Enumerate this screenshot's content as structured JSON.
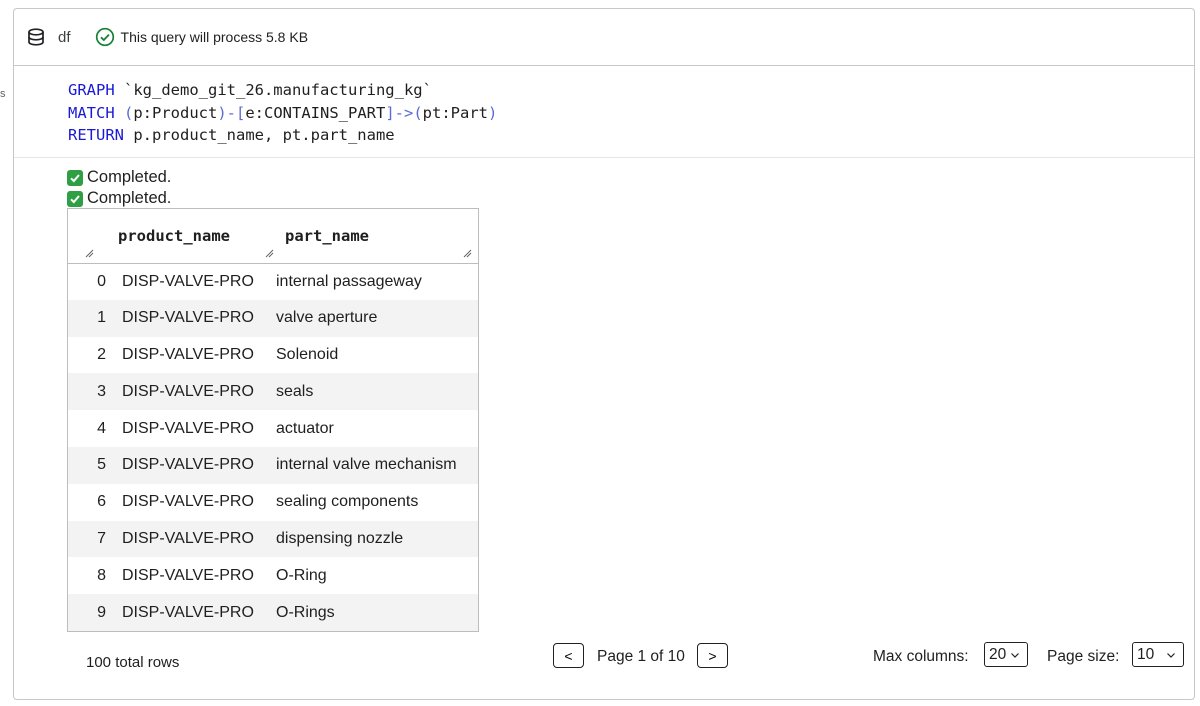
{
  "edge_fragment": "s",
  "header": {
    "dataframe_name": "df",
    "process_message": "This query will process 5.8 KB"
  },
  "code": {
    "line1": {
      "keyword": "GRAPH",
      "rest": " `kg_demo_git_26.manufacturing_kg`"
    },
    "line2": {
      "keyword": "MATCH",
      "open": " (",
      "node1": "p:Product",
      "arrow1": ")-[",
      "edge": "e:CONTAINS_PART",
      "arrow2": "]->(",
      "node2": "pt:Part",
      "close": ")"
    },
    "line3": {
      "keyword": "RETURN",
      "rest": " p.product_name, pt.part_name"
    }
  },
  "status": [
    "Completed.",
    "Completed."
  ],
  "table": {
    "columns": [
      "product_name",
      "part_name"
    ],
    "rows": [
      {
        "idx": "0",
        "product_name": "DISP-VALVE-PRO",
        "part_name": "internal passageway"
      },
      {
        "idx": "1",
        "product_name": "DISP-VALVE-PRO",
        "part_name": "valve aperture"
      },
      {
        "idx": "2",
        "product_name": "DISP-VALVE-PRO",
        "part_name": "Solenoid"
      },
      {
        "idx": "3",
        "product_name": "DISP-VALVE-PRO",
        "part_name": "seals"
      },
      {
        "idx": "4",
        "product_name": "DISP-VALVE-PRO",
        "part_name": "actuator"
      },
      {
        "idx": "5",
        "product_name": "DISP-VALVE-PRO",
        "part_name": "internal valve mechanism"
      },
      {
        "idx": "6",
        "product_name": "DISP-VALVE-PRO",
        "part_name": "sealing components"
      },
      {
        "idx": "7",
        "product_name": "DISP-VALVE-PRO",
        "part_name": "dispensing nozzle"
      },
      {
        "idx": "8",
        "product_name": "DISP-VALVE-PRO",
        "part_name": "O-Ring"
      },
      {
        "idx": "9",
        "product_name": "DISP-VALVE-PRO",
        "part_name": "O-Rings"
      }
    ]
  },
  "footer": {
    "total_rows": "100 total rows",
    "prev_label": "<",
    "page_info": "Page 1 of 10",
    "next_label": ">",
    "max_columns_label": "Max columns:",
    "max_columns_value": "20",
    "page_size_label": "Page size:",
    "page_size_value": "10"
  },
  "colors": {
    "keyword": "#1a1ad6",
    "operator": "#5b6ad6",
    "success_green": "#2ea043",
    "check_circle_green": "#188038"
  },
  "icons": [
    "database-icon",
    "check-circle-icon",
    "checkmark-box-icon",
    "resize-handle-icon",
    "chevron-down-icon"
  ]
}
